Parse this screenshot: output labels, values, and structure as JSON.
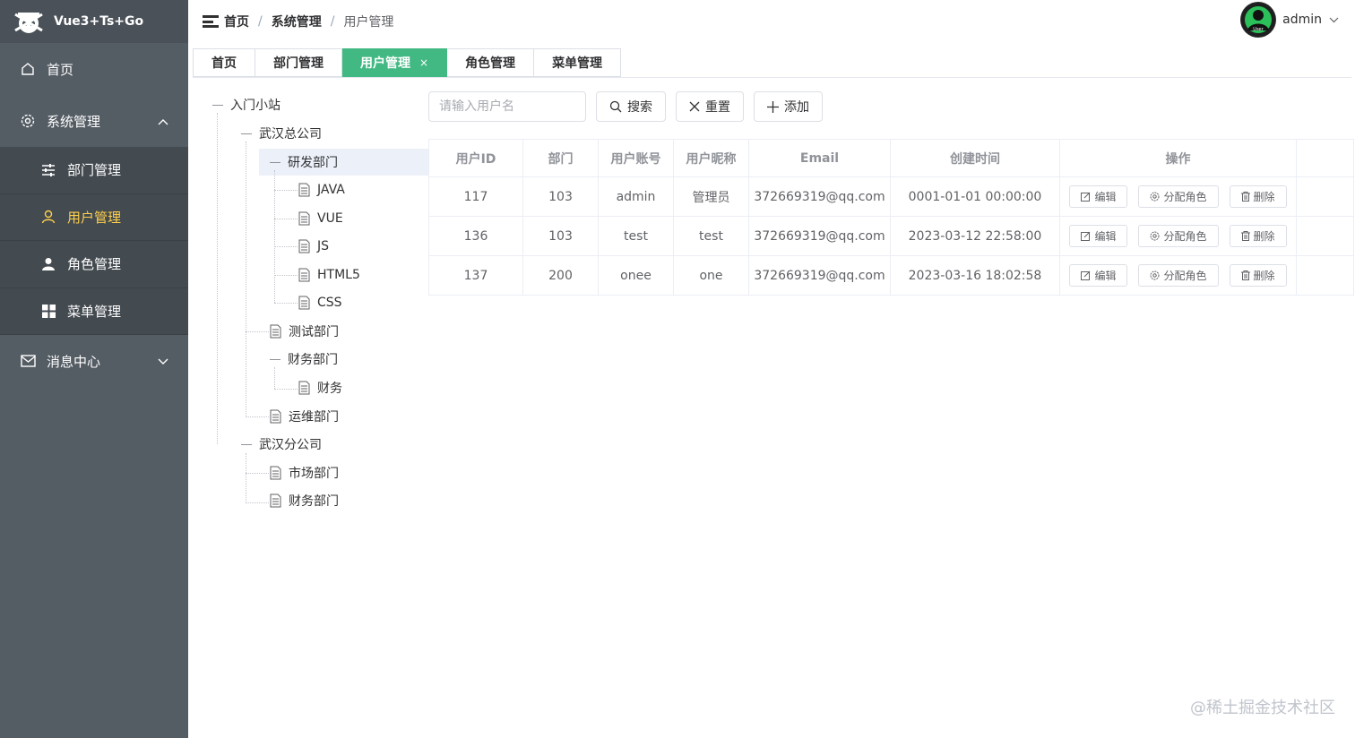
{
  "app": {
    "title": "Vue3+Ts+Go"
  },
  "sidebar": {
    "items": [
      {
        "label": "首页",
        "icon": "home-icon"
      },
      {
        "label": "系统管理",
        "icon": "gear-icon",
        "expanded": true,
        "children": [
          {
            "label": "部门管理",
            "icon": "sliders-icon"
          },
          {
            "label": "用户管理",
            "icon": "user-icon",
            "active": true
          },
          {
            "label": "角色管理",
            "icon": "person-icon"
          },
          {
            "label": "菜单管理",
            "icon": "grid-icon"
          }
        ]
      },
      {
        "label": "消息中心",
        "icon": "mail-icon",
        "expanded": false
      }
    ]
  },
  "header": {
    "breadcrumb": [
      "首页",
      "系统管理",
      "用户管理"
    ],
    "separator": "/",
    "user": {
      "name": "admin",
      "avatar_text": "User"
    }
  },
  "tabs": [
    {
      "label": "首页"
    },
    {
      "label": "部门管理"
    },
    {
      "label": "用户管理",
      "active": true,
      "close": "×"
    },
    {
      "label": "角色管理"
    },
    {
      "label": "菜单管理"
    }
  ],
  "tree": {
    "nodes": [
      "入门小站",
      "武汉总公司",
      "研发部门",
      "JAVA",
      "VUE",
      "JS",
      "HTML5",
      "CSS",
      "测试部门",
      "财务部门",
      "财务",
      "运维部门",
      "武汉分公司",
      "市场部门",
      "财务部门"
    ],
    "selected": "研发部门"
  },
  "toolbar": {
    "search_placeholder": "请输入用户名",
    "search_label": "搜索",
    "reset_label": "重置",
    "add_label": "添加"
  },
  "table": {
    "columns": [
      "用户ID",
      "部门",
      "用户账号",
      "用户昵称",
      "Email",
      "创建时间",
      "操作"
    ],
    "rows": [
      [
        "117",
        "103",
        "admin",
        "管理员",
        "372669319@qq.com",
        "0001-01-01 00:00:00"
      ],
      [
        "136",
        "103",
        "test",
        "test",
        "372669319@qq.com",
        "2023-03-12 22:58:00"
      ],
      [
        "137",
        "200",
        "onee",
        "one",
        "372669319@qq.com",
        "2023-03-16 18:02:58"
      ]
    ],
    "actions": {
      "edit": "编辑",
      "assign_role": "分配角色",
      "delete": "删除"
    }
  },
  "watermark": "@稀土掘金技术社区",
  "colors": {
    "sidebar": "#545c64",
    "active_menu": "#ffd04b",
    "active_tab": "#42b983"
  }
}
